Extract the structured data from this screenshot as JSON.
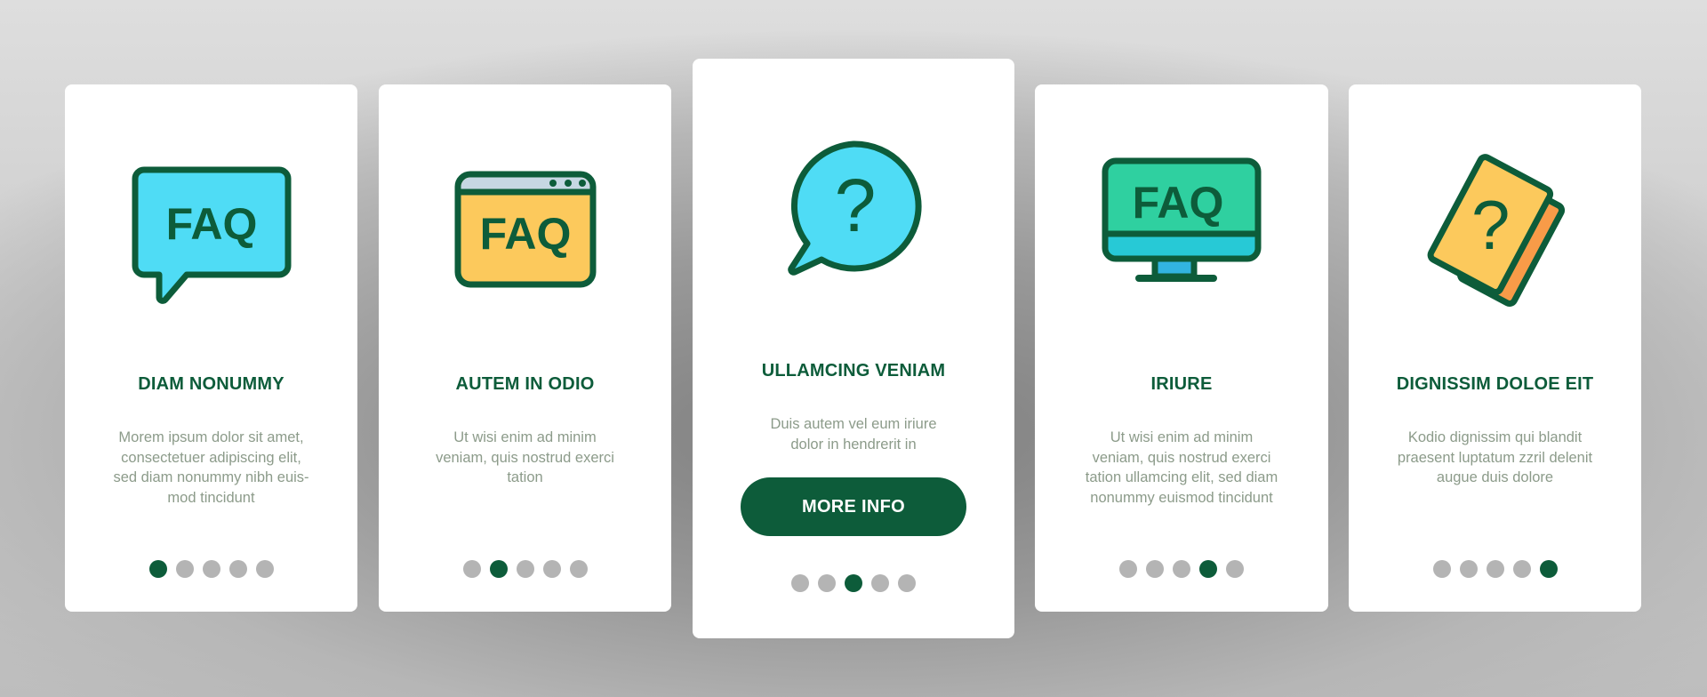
{
  "colors": {
    "primary": "#0d5c3a",
    "body_text": "#8c9b8a",
    "dot_inactive": "#b4b4b4",
    "card_bg": "#ffffff",
    "cyan": "#4fdcf5",
    "yellow": "#fcc95c",
    "light_blue_gray": "#c6d7e3",
    "teal_green": "#2fd0a0",
    "teal_blue": "#27c9d6",
    "orange": "#f89b48"
  },
  "cards": [
    {
      "icon": "faq-speech-bubble-icon",
      "icon_text": "FAQ",
      "title": "DIAM NONUMMY",
      "body": "Morem ipsum dolor sit amet,\nconsectetuer adipiscing elit,\nsed diam nonummy nibh euis-\nmod tincidunt",
      "active_dot": 1,
      "total_dots": 5
    },
    {
      "icon": "faq-browser-window-icon",
      "icon_text": "FAQ",
      "title": "AUTEM IN ODIO",
      "body": "Ut wisi enim ad minim\nveniam, quis nostrud exerci\ntation",
      "active_dot": 2,
      "total_dots": 5
    },
    {
      "icon": "question-speech-bubble-icon",
      "icon_text": "?",
      "title": "ULLAMCING VENIAM",
      "body": "Duis autem vel eum iriure\ndolor in hendrerit in",
      "button_label": "MORE INFO",
      "active_dot": 3,
      "total_dots": 5
    },
    {
      "icon": "faq-monitor-icon",
      "icon_text": "FAQ",
      "title": "IRIURE",
      "body": "Ut wisi enim ad minim\nveniam, quis nostrud exerci\ntation ullamcing elit, sed diam\nnonummy euismod tincidunt",
      "active_dot": 4,
      "total_dots": 5
    },
    {
      "icon": "question-book-icon",
      "icon_text": "?",
      "title": "DIGNISSIM DOLOE EIT",
      "body": "Kodio dignissim qui blandit\npraesent luptatum zzril delenit\naugue duis dolore",
      "active_dot": 5,
      "total_dots": 5
    }
  ]
}
